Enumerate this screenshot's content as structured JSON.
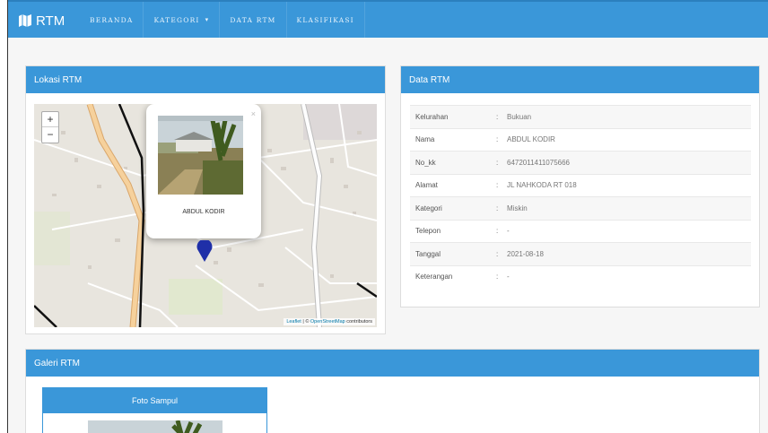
{
  "brand": {
    "icon": "map-icon",
    "title": "RTM"
  },
  "nav": [
    {
      "label": "BERANDA"
    },
    {
      "label": "KATEGORI",
      "caret": "▾"
    },
    {
      "label": "DATA RTM"
    },
    {
      "label": "KLASIFIKASI"
    }
  ],
  "lokasi": {
    "title": "Lokasi RTM",
    "zoom_in": "+",
    "zoom_out": "−",
    "popup": {
      "close": "×",
      "name": "ABDUL KODIR"
    },
    "attribution": {
      "leaflet": "Leaflet",
      "sep": " | © ",
      "osm": "OpenStreetMap",
      "suffix": " contributors"
    }
  },
  "data_rtm": {
    "title": "Data RTM",
    "rows": [
      {
        "key": "Kelurahan",
        "sep": ":",
        "value": "Bukuan"
      },
      {
        "key": "Nama",
        "sep": ":",
        "value": "ABDUL KODIR"
      },
      {
        "key": "No_kk",
        "sep": ":",
        "value": "6472011411075666"
      },
      {
        "key": "Alamat",
        "sep": ":",
        "value": "JL NAHKODA RT 018"
      },
      {
        "key": "Kategori",
        "sep": ":",
        "value": "Miskin"
      },
      {
        "key": "Telepon",
        "sep": ":",
        "value": "-"
      },
      {
        "key": "Tanggal",
        "sep": ":",
        "value": "2021-08-18"
      },
      {
        "key": "Keterangan",
        "sep": ":",
        "value": "-"
      }
    ]
  },
  "galeri": {
    "title": "Galeri RTM",
    "card_title": "Foto Sampul"
  },
  "colors": {
    "primary": "#3a97d9",
    "marker": "#1f2fa8"
  }
}
